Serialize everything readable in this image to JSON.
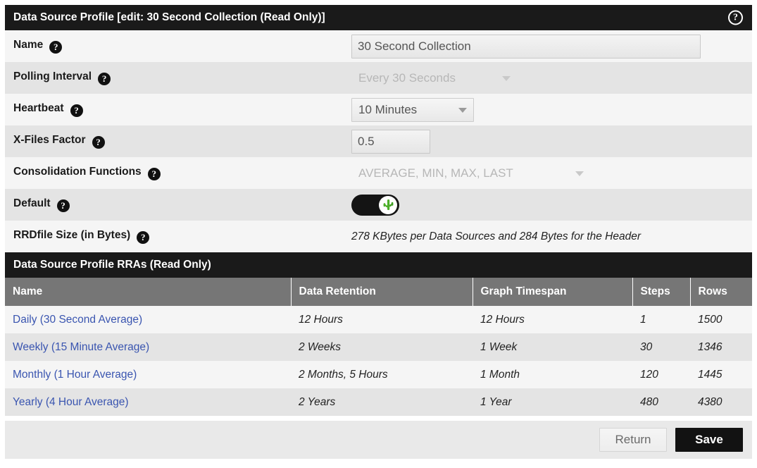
{
  "profile_panel": {
    "title": "Data Source Profile [edit: 30 Second Collection (Read Only)]",
    "help_icon": "?",
    "help_icon_name": "help-circle-icon",
    "fields": [
      {
        "label": "Name",
        "help": "?",
        "type": "text",
        "value": "30 Second Collection",
        "disabled": false
      },
      {
        "label": "Polling Interval",
        "help": "?",
        "type": "select",
        "value": "Every 30 Seconds",
        "disabled": true
      },
      {
        "label": "Heartbeat",
        "help": "?",
        "type": "select",
        "value": "10 Minutes",
        "disabled": false
      },
      {
        "label": "X-Files Factor",
        "help": "?",
        "type": "text",
        "value": "0.5",
        "disabled": false
      },
      {
        "label": "Consolidation Functions",
        "help": "?",
        "type": "select",
        "value": "AVERAGE, MIN, MAX, LAST",
        "disabled": true
      },
      {
        "label": "Default",
        "help": "?",
        "type": "toggle",
        "value": "on",
        "disabled": false
      },
      {
        "label": "RRDfile Size (in Bytes)",
        "help": "?",
        "type": "static",
        "value": "278 KBytes per Data Sources and 284 Bytes for the Header",
        "disabled": false
      }
    ]
  },
  "rra_panel": {
    "title": "Data Source Profile RRAs (Read Only)",
    "columns": [
      "Name",
      "Data Retention",
      "Graph Timespan",
      "Steps",
      "Rows"
    ],
    "rows": [
      {
        "name": "Daily (30 Second Average)",
        "data_retention": "12 Hours",
        "graph_timespan": "12 Hours",
        "steps": "1",
        "rows": "1500"
      },
      {
        "name": "Weekly (15 Minute Average)",
        "data_retention": "2 Weeks",
        "graph_timespan": "1 Week",
        "steps": "30",
        "rows": "1346"
      },
      {
        "name": "Monthly (1 Hour Average)",
        "data_retention": "2 Months, 5 Hours",
        "graph_timespan": "1 Month",
        "steps": "120",
        "rows": "1445"
      },
      {
        "name": "Yearly (4 Hour Average)",
        "data_retention": "2 Years",
        "graph_timespan": "1 Year",
        "steps": "480",
        "rows": "4380"
      }
    ]
  },
  "actions": {
    "return_label": "Return",
    "save_label": "Save"
  },
  "colors": {
    "header_bg": "#1a1a1a",
    "table_header_bg": "#767676",
    "row_odd": "#f5f5f5",
    "row_even": "#e4e4e4",
    "link": "#3a55b0",
    "toggle_on": "#141414",
    "cactus_green": "#4caf2a",
    "save_bg": "#121212"
  }
}
